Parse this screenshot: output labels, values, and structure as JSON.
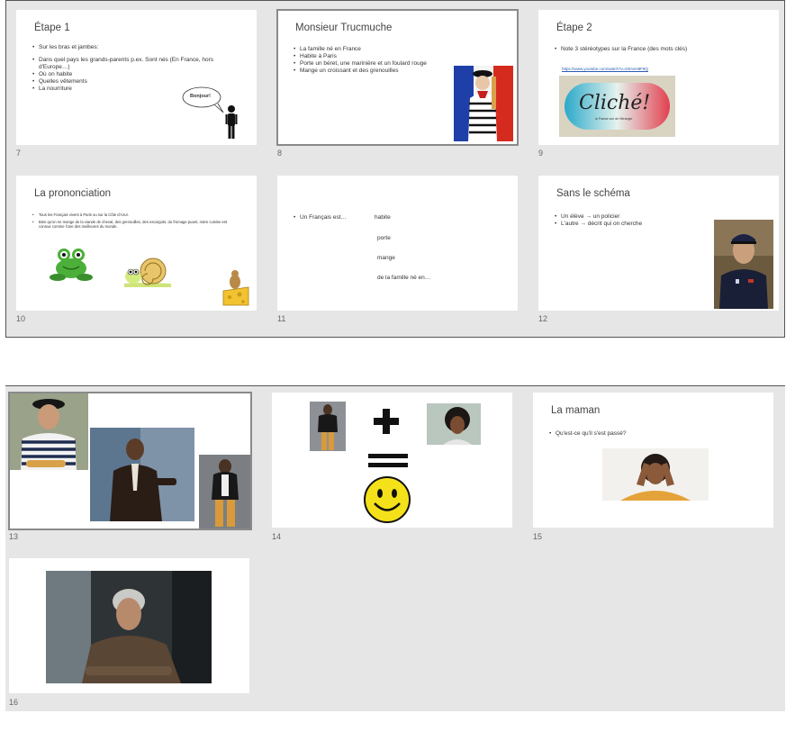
{
  "slides": [
    {
      "number": "7",
      "title": "Étape 1",
      "bullets": [
        "Sur les bras et jambes:",
        "Dans quel pays les grands-parents p.ex. Sont nés (En France, hors d'Europe…)",
        "Où on habite",
        "Quelles vêtements",
        "La nourriture"
      ],
      "speech": "Bonjour!"
    },
    {
      "number": "8",
      "title": "Monsieur Trucmuche",
      "bullets": [
        "La famille né en France",
        "Habite à Paris",
        "Porte un béret, une marinière et un foulard rouge",
        "Mange un croissant et des grenouilles"
      ]
    },
    {
      "number": "9",
      "title": "Étape 2",
      "bullets": [
        "Note 3 stéréotypes sur la France (des mots clés)"
      ],
      "link": "https://www.youtube.com/watch?v=D0AsH8F9Q",
      "logo_text": "Cliché!",
      "logo_sub": "la France vue de l'étranger"
    },
    {
      "number": "10",
      "title": "La prononciation",
      "bullets": [
        "Tous les Français vivent à Paris ou sur la Côte d'Azur.",
        "Bien qu'on ne mange de la viande de cheval, des grenouilles, des escargots, du fromage puant, notre cuisine est connue comme l'une des meilleures du monde."
      ]
    },
    {
      "number": "11",
      "bullet": "Un Français est…",
      "words": [
        "habite",
        "porte",
        "mange",
        "de la famille né en…"
      ]
    },
    {
      "number": "12",
      "title": "Sans le schéma",
      "bullets": [
        "Un élève → un policier",
        "L'autre → décrit qui on cherche"
      ]
    },
    {
      "number": "13"
    },
    {
      "number": "14"
    },
    {
      "number": "15",
      "title": "La maman",
      "bullets": [
        "Qu'est-ce qu'il s'est passé?"
      ]
    },
    {
      "number": "16"
    }
  ],
  "colors": {
    "panel_bg": "#e6e6e6",
    "flag_blue": "#1f3fa8",
    "flag_red": "#d52b1e",
    "smiley": "#f5e11a"
  }
}
